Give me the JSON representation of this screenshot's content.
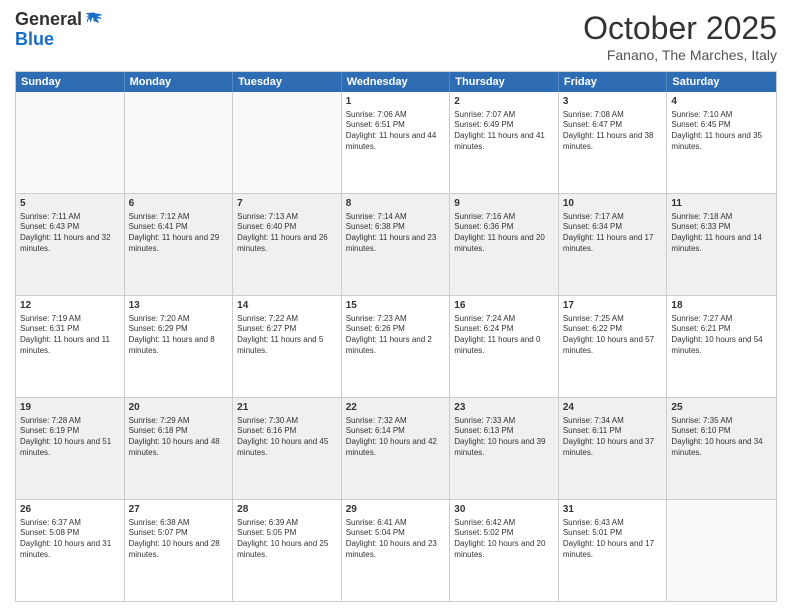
{
  "header": {
    "logo_line1": "General",
    "logo_line2": "Blue",
    "month_title": "October 2025",
    "subtitle": "Fanano, The Marches, Italy"
  },
  "days_of_week": [
    "Sunday",
    "Monday",
    "Tuesday",
    "Wednesday",
    "Thursday",
    "Friday",
    "Saturday"
  ],
  "weeks": [
    [
      {
        "num": "",
        "info": "",
        "empty": true
      },
      {
        "num": "",
        "info": "",
        "empty": true
      },
      {
        "num": "",
        "info": "",
        "empty": true
      },
      {
        "num": "1",
        "info": "Sunrise: 7:06 AM\nSunset: 6:51 PM\nDaylight: 11 hours and 44 minutes."
      },
      {
        "num": "2",
        "info": "Sunrise: 7:07 AM\nSunset: 6:49 PM\nDaylight: 11 hours and 41 minutes."
      },
      {
        "num": "3",
        "info": "Sunrise: 7:08 AM\nSunset: 6:47 PM\nDaylight: 11 hours and 38 minutes."
      },
      {
        "num": "4",
        "info": "Sunrise: 7:10 AM\nSunset: 6:45 PM\nDaylight: 11 hours and 35 minutes."
      }
    ],
    [
      {
        "num": "5",
        "info": "Sunrise: 7:11 AM\nSunset: 6:43 PM\nDaylight: 11 hours and 32 minutes.",
        "shaded": true
      },
      {
        "num": "6",
        "info": "Sunrise: 7:12 AM\nSunset: 6:41 PM\nDaylight: 11 hours and 29 minutes.",
        "shaded": true
      },
      {
        "num": "7",
        "info": "Sunrise: 7:13 AM\nSunset: 6:40 PM\nDaylight: 11 hours and 26 minutes.",
        "shaded": true
      },
      {
        "num": "8",
        "info": "Sunrise: 7:14 AM\nSunset: 6:38 PM\nDaylight: 11 hours and 23 minutes.",
        "shaded": true
      },
      {
        "num": "9",
        "info": "Sunrise: 7:16 AM\nSunset: 6:36 PM\nDaylight: 11 hours and 20 minutes.",
        "shaded": true
      },
      {
        "num": "10",
        "info": "Sunrise: 7:17 AM\nSunset: 6:34 PM\nDaylight: 11 hours and 17 minutes.",
        "shaded": true
      },
      {
        "num": "11",
        "info": "Sunrise: 7:18 AM\nSunset: 6:33 PM\nDaylight: 11 hours and 14 minutes.",
        "shaded": true
      }
    ],
    [
      {
        "num": "12",
        "info": "Sunrise: 7:19 AM\nSunset: 6:31 PM\nDaylight: 11 hours and 11 minutes."
      },
      {
        "num": "13",
        "info": "Sunrise: 7:20 AM\nSunset: 6:29 PM\nDaylight: 11 hours and 8 minutes."
      },
      {
        "num": "14",
        "info": "Sunrise: 7:22 AM\nSunset: 6:27 PM\nDaylight: 11 hours and 5 minutes."
      },
      {
        "num": "15",
        "info": "Sunrise: 7:23 AM\nSunset: 6:26 PM\nDaylight: 11 hours and 2 minutes."
      },
      {
        "num": "16",
        "info": "Sunrise: 7:24 AM\nSunset: 6:24 PM\nDaylight: 11 hours and 0 minutes."
      },
      {
        "num": "17",
        "info": "Sunrise: 7:25 AM\nSunset: 6:22 PM\nDaylight: 10 hours and 57 minutes."
      },
      {
        "num": "18",
        "info": "Sunrise: 7:27 AM\nSunset: 6:21 PM\nDaylight: 10 hours and 54 minutes."
      }
    ],
    [
      {
        "num": "19",
        "info": "Sunrise: 7:28 AM\nSunset: 6:19 PM\nDaylight: 10 hours and 51 minutes.",
        "shaded": true
      },
      {
        "num": "20",
        "info": "Sunrise: 7:29 AM\nSunset: 6:18 PM\nDaylight: 10 hours and 48 minutes.",
        "shaded": true
      },
      {
        "num": "21",
        "info": "Sunrise: 7:30 AM\nSunset: 6:16 PM\nDaylight: 10 hours and 45 minutes.",
        "shaded": true
      },
      {
        "num": "22",
        "info": "Sunrise: 7:32 AM\nSunset: 6:14 PM\nDaylight: 10 hours and 42 minutes.",
        "shaded": true
      },
      {
        "num": "23",
        "info": "Sunrise: 7:33 AM\nSunset: 6:13 PM\nDaylight: 10 hours and 39 minutes.",
        "shaded": true
      },
      {
        "num": "24",
        "info": "Sunrise: 7:34 AM\nSunset: 6:11 PM\nDaylight: 10 hours and 37 minutes.",
        "shaded": true
      },
      {
        "num": "25",
        "info": "Sunrise: 7:35 AM\nSunset: 6:10 PM\nDaylight: 10 hours and 34 minutes.",
        "shaded": true
      }
    ],
    [
      {
        "num": "26",
        "info": "Sunrise: 6:37 AM\nSunset: 5:08 PM\nDaylight: 10 hours and 31 minutes."
      },
      {
        "num": "27",
        "info": "Sunrise: 6:38 AM\nSunset: 5:07 PM\nDaylight: 10 hours and 28 minutes."
      },
      {
        "num": "28",
        "info": "Sunrise: 6:39 AM\nSunset: 5:05 PM\nDaylight: 10 hours and 25 minutes."
      },
      {
        "num": "29",
        "info": "Sunrise: 6:41 AM\nSunset: 5:04 PM\nDaylight: 10 hours and 23 minutes."
      },
      {
        "num": "30",
        "info": "Sunrise: 6:42 AM\nSunset: 5:02 PM\nDaylight: 10 hours and 20 minutes."
      },
      {
        "num": "31",
        "info": "Sunrise: 6:43 AM\nSunset: 5:01 PM\nDaylight: 10 hours and 17 minutes."
      },
      {
        "num": "",
        "info": "",
        "empty": true
      }
    ]
  ]
}
